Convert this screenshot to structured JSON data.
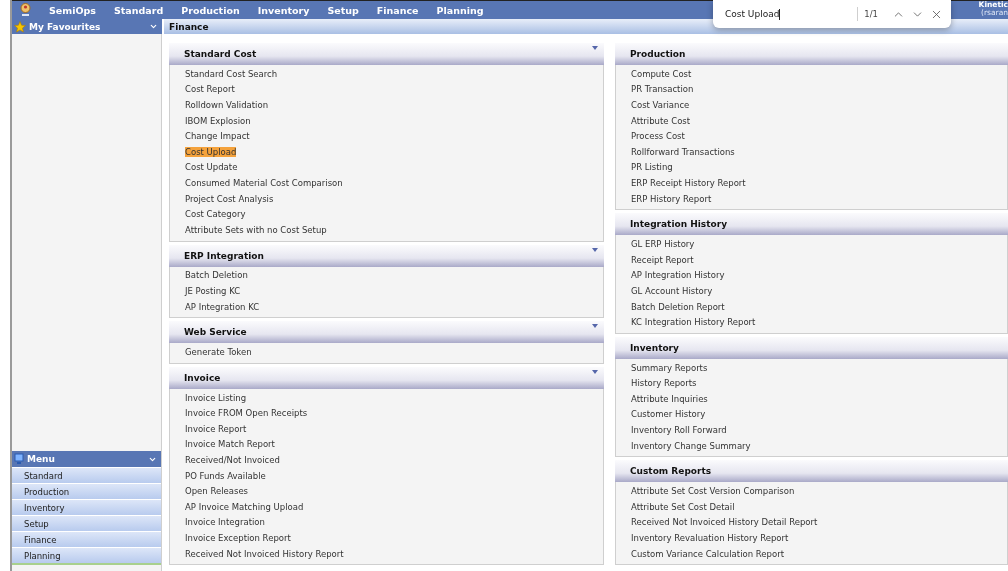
{
  "top_nav": {
    "items": [
      "SemiOps",
      "Standard",
      "Production",
      "Inventory",
      "Setup",
      "Finance",
      "Planning"
    ],
    "user": [
      "Kinetic",
      "(rsaran"
    ]
  },
  "find_bar": {
    "value": "Cost Upload",
    "count": "1/1"
  },
  "sidebar": {
    "favourites_title": "My Favourites",
    "menu_title": "Menu",
    "menu_items": [
      "Standard",
      "Production",
      "Inventory",
      "Setup",
      "Finance",
      "Planning"
    ]
  },
  "breadcrumb": "Finance",
  "columns": [
    [
      {
        "title": "Standard Cost",
        "caret": true,
        "items": [
          {
            "label": "Standard Cost Search",
            "highlighted": false
          },
          {
            "label": "Cost Report",
            "highlighted": false
          },
          {
            "label": "Rolldown Validation",
            "highlighted": false
          },
          {
            "label": "IBOM Explosion",
            "highlighted": false
          },
          {
            "label": "Change Impact",
            "highlighted": false
          },
          {
            "label": "Cost Upload",
            "highlighted": true
          },
          {
            "label": "Cost Update",
            "highlighted": false
          },
          {
            "label": "Consumed Material Cost Comparison",
            "highlighted": false
          },
          {
            "label": "Project Cost Analysis",
            "highlighted": false
          },
          {
            "label": "Cost Category",
            "highlighted": false
          },
          {
            "label": "Attribute Sets with no Cost Setup",
            "highlighted": false
          }
        ]
      },
      {
        "title": "ERP Integration",
        "caret": true,
        "items": [
          {
            "label": "Batch Deletion",
            "highlighted": false
          },
          {
            "label": "JE Posting KC",
            "highlighted": false
          },
          {
            "label": "AP Integration KC",
            "highlighted": false
          }
        ]
      },
      {
        "title": "Web Service",
        "caret": true,
        "items": [
          {
            "label": "Generate Token",
            "highlighted": false
          }
        ]
      },
      {
        "title": "Invoice",
        "caret": true,
        "items": [
          {
            "label": "Invoice Listing",
            "highlighted": false
          },
          {
            "label": "Invoice FROM Open Receipts",
            "highlighted": false
          },
          {
            "label": "Invoice Report",
            "highlighted": false
          },
          {
            "label": "Invoice Match Report",
            "highlighted": false
          },
          {
            "label": "Received/Not Invoiced",
            "highlighted": false
          },
          {
            "label": "PO Funds Available",
            "highlighted": false
          },
          {
            "label": "Open Releases",
            "highlighted": false
          },
          {
            "label": "AP Invoice Matching Upload",
            "highlighted": false
          },
          {
            "label": "Invoice Integration",
            "highlighted": false
          },
          {
            "label": "Invoice Exception Report",
            "highlighted": false
          },
          {
            "label": "Received Not Invoiced History Report",
            "highlighted": false
          }
        ]
      }
    ],
    [
      {
        "title": "Production",
        "caret": false,
        "items": [
          {
            "label": "Compute Cost",
            "highlighted": false
          },
          {
            "label": "PR Transaction",
            "highlighted": false
          },
          {
            "label": "Cost Variance",
            "highlighted": false
          },
          {
            "label": "Attribute Cost",
            "highlighted": false
          },
          {
            "label": "Process Cost",
            "highlighted": false
          },
          {
            "label": "Rollforward Transactions",
            "highlighted": false
          },
          {
            "label": "PR Listing",
            "highlighted": false
          },
          {
            "label": "ERP Receipt History Report",
            "highlighted": false
          },
          {
            "label": "ERP History Report",
            "highlighted": false
          }
        ]
      },
      {
        "title": "Integration History",
        "caret": false,
        "items": [
          {
            "label": "GL ERP History",
            "highlighted": false
          },
          {
            "label": "Receipt Report",
            "highlighted": false
          },
          {
            "label": "AP Integration History",
            "highlighted": false
          },
          {
            "label": "GL Account History",
            "highlighted": false
          },
          {
            "label": "Batch Deletion Report",
            "highlighted": false
          },
          {
            "label": "KC Integration History Report",
            "highlighted": false
          }
        ]
      },
      {
        "title": "Inventory",
        "caret": false,
        "items": [
          {
            "label": "Summary Reports",
            "highlighted": false
          },
          {
            "label": "History Reports",
            "highlighted": false
          },
          {
            "label": "Attribute Inquiries",
            "highlighted": false
          },
          {
            "label": "Customer History",
            "highlighted": false
          },
          {
            "label": "Inventory Roll Forward",
            "highlighted": false
          },
          {
            "label": "Inventory Change Summary",
            "highlighted": false
          }
        ]
      },
      {
        "title": "Custom Reports",
        "caret": false,
        "items": [
          {
            "label": "Attribute Set Cost Version Comparison",
            "highlighted": false
          },
          {
            "label": "Attribute Set Cost Detail",
            "highlighted": false
          },
          {
            "label": "Received Not Invoiced History Detail Report",
            "highlighted": false
          },
          {
            "label": "Inventory Revaluation History Report",
            "highlighted": false
          },
          {
            "label": "Custom Variance Calculation Report",
            "highlighted": false
          }
        ]
      }
    ]
  ]
}
